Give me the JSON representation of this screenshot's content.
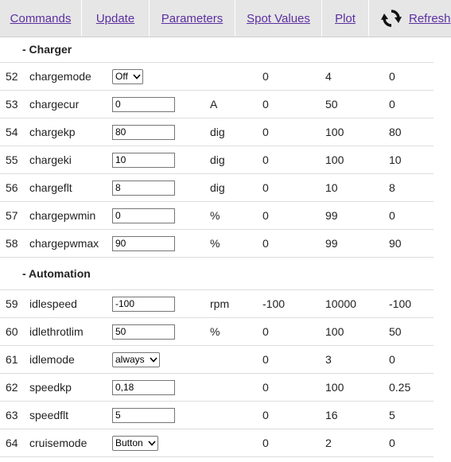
{
  "nav": {
    "commands": "Commands",
    "update": "Update",
    "parameters": "Parameters",
    "spot_values": "Spot Values",
    "plot": "Plot",
    "refresh": "Refresh",
    "refresh_icon": "refresh-icon"
  },
  "sections": [
    {
      "title": "- Charger",
      "rows": [
        {
          "num": "52",
          "name": "chargemode",
          "value": "Off",
          "type": "select",
          "unit": "",
          "min": "0",
          "max": "4",
          "default": "0"
        },
        {
          "num": "53",
          "name": "chargecur",
          "value": "0",
          "type": "text",
          "unit": "A",
          "min": "0",
          "max": "50",
          "default": "0"
        },
        {
          "num": "54",
          "name": "chargekp",
          "value": "80",
          "type": "text",
          "unit": "dig",
          "min": "0",
          "max": "100",
          "default": "80"
        },
        {
          "num": "55",
          "name": "chargeki",
          "value": "10",
          "type": "text",
          "unit": "dig",
          "min": "0",
          "max": "100",
          "default": "10"
        },
        {
          "num": "56",
          "name": "chargeflt",
          "value": "8",
          "type": "text",
          "unit": "dig",
          "min": "0",
          "max": "10",
          "default": "8"
        },
        {
          "num": "57",
          "name": "chargepwmin",
          "value": "0",
          "type": "text",
          "unit": "%",
          "min": "0",
          "max": "99",
          "default": "0"
        },
        {
          "num": "58",
          "name": "chargepwmax",
          "value": "90",
          "type": "text",
          "unit": "%",
          "min": "0",
          "max": "99",
          "default": "90"
        }
      ]
    },
    {
      "title": "- Automation",
      "rows": [
        {
          "num": "59",
          "name": "idlespeed",
          "value": "-100",
          "type": "text",
          "unit": "rpm",
          "min": "-100",
          "max": "10000",
          "default": "-100"
        },
        {
          "num": "60",
          "name": "idlethrotlim",
          "value": "50",
          "type": "text",
          "unit": "%",
          "min": "0",
          "max": "100",
          "default": "50"
        },
        {
          "num": "61",
          "name": "idlemode",
          "value": "always",
          "type": "select",
          "unit": "",
          "min": "0",
          "max": "3",
          "default": "0"
        },
        {
          "num": "62",
          "name": "speedkp",
          "value": "0,18",
          "type": "text",
          "unit": "",
          "min": "0",
          "max": "100",
          "default": "0.25"
        },
        {
          "num": "63",
          "name": "speedflt",
          "value": "5",
          "type": "text",
          "unit": "",
          "min": "0",
          "max": "16",
          "default": "5"
        },
        {
          "num": "64",
          "name": "cruisemode",
          "value": "Button",
          "type": "select",
          "unit": "",
          "min": "0",
          "max": "2",
          "default": "0"
        }
      ]
    }
  ]
}
